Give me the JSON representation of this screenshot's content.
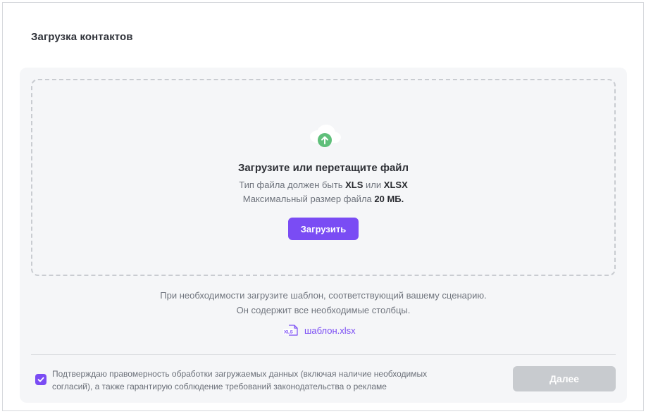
{
  "page": {
    "title": "Загрузка контактов"
  },
  "dropzone": {
    "icon": "cloud-upload-icon",
    "title": "Загрузите или перетащите файл",
    "type_prefix": "Тип файла должен быть",
    "type_xls": "XLS",
    "type_or": "или",
    "type_xlsx": "XLSX",
    "size_prefix": "Максимальный размер файла",
    "size_value": "20 МБ.",
    "upload_button": "Загрузить"
  },
  "template": {
    "hint_line1": "При необходимости загрузите шаблон, соответствующий вашему сценарию.",
    "hint_line2": "Он содержит все необходимые столбцы.",
    "file_icon_label": "XLS",
    "link_text": "шаблон.xlsx"
  },
  "consent": {
    "checked": true,
    "text_line1": "Подтверждаю правомерность обработки загружаемых данных (включая наличие необходимых",
    "text_line2": "согласий), а также гарантирую соблюдение требований законодательства о рекламе"
  },
  "footer": {
    "next_button": "Далее",
    "next_enabled": false
  },
  "colors": {
    "accent": "#7a4cf4",
    "upload_icon": "#5fbf7a",
    "disabled_button": "#c8cbcf"
  }
}
